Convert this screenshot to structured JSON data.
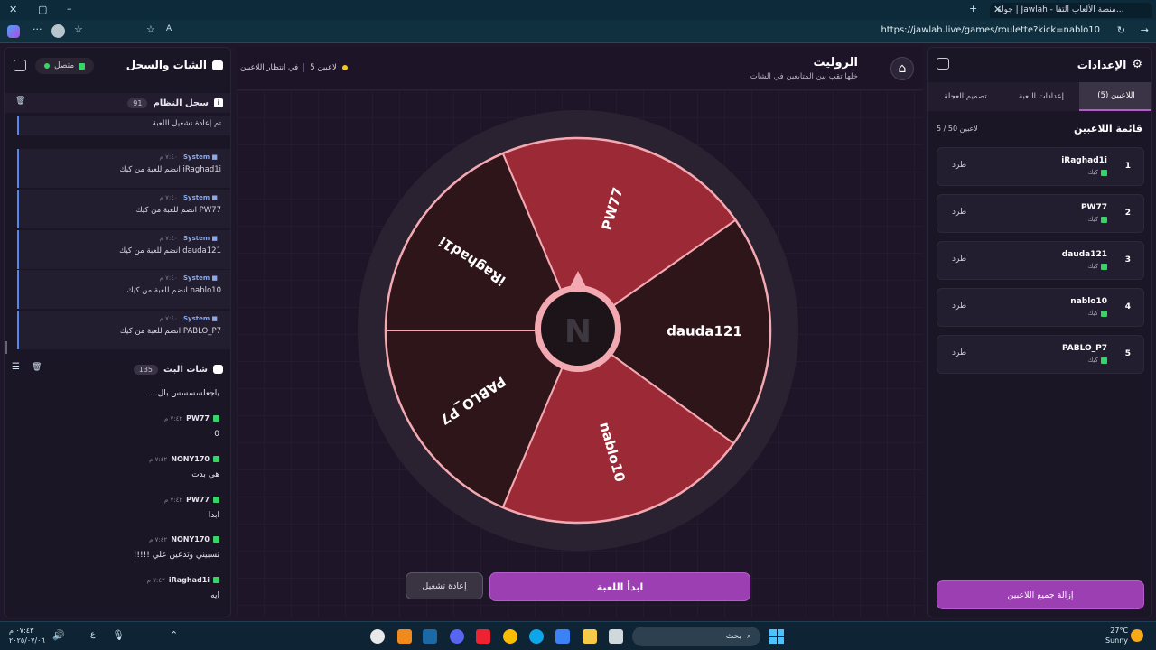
{
  "browser": {
    "tab_title": "جولة | Jawlah - منصة الألعاب التفا...",
    "url": "https://jawlah.live/games/roulette?kick=nablo10"
  },
  "chat": {
    "title": "الشات والسجل",
    "status": "متصل",
    "log_title": "سجل النظام",
    "log_count": "91",
    "log_items": [
      {
        "meta": "",
        "time": "",
        "text": "تم إعادة تشغيل اللعبة"
      },
      {
        "meta": "System",
        "time": "٧:٤٠ م",
        "text": "iRaghad1i انضم للعبة من كيك"
      },
      {
        "meta": "System",
        "time": "٧:٤٠ م",
        "text": "PW77 انضم للعبة من كيك"
      },
      {
        "meta": "System",
        "time": "٧:٤٠ م",
        "text": "dauda121 انضم للعبة من كيك"
      },
      {
        "meta": "System",
        "time": "٧:٤٠ م",
        "text": "nablo10 انضم للعبة من كيك"
      },
      {
        "meta": "System",
        "time": "٧:٤٠ م",
        "text": "PABLO_P7 انضم للعبة من كيك"
      }
    ],
    "live_title": "شات البث",
    "live_count": "135",
    "first_text": "ياجعلسسسس بال...",
    "messages": [
      {
        "user": "PW77",
        "time": "٧:٤٢ م",
        "text": "0"
      },
      {
        "user": "NONY170",
        "time": "٧:٤٢ م",
        "text": "هي بدت"
      },
      {
        "user": "PW77",
        "time": "٧:٤٢ م",
        "text": "ابدا"
      },
      {
        "user": "NONY170",
        "time": "٧:٤٢ م",
        "text": "تسبيني وتدعين علي !!!!!"
      },
      {
        "user": "iRaghad1i",
        "time": "٧:٤٢ م",
        "text": "ايه"
      }
    ]
  },
  "main": {
    "title": "الروليت",
    "subtitle": "خلها تقب بين المتابعين في الشات",
    "waiting": "في انتظار اللاعبين",
    "players_count": "5 لاعبين",
    "start_button": "ابدأ اللعبة",
    "restart_button": "إعادة تشغيل",
    "wheel": {
      "segments": [
        {
          "name": "PW77",
          "color": "#9b2a36"
        },
        {
          "name": "dauda121",
          "color": "#2e1519"
        },
        {
          "name": "nablo10",
          "color": "#9b2a36"
        },
        {
          "name": "PABLO_P7",
          "color": "#2e1519"
        },
        {
          "name": "iRaghad1i",
          "color": "#2e1519"
        }
      ]
    }
  },
  "settings": {
    "title": "الإعدادات",
    "tabs": [
      "اللاعبين (5)",
      "إعدادات اللعبة",
      "تصميم العجلة"
    ],
    "list_title": "قائمة اللاعبين",
    "list_count": "5 / 50 لاعبين",
    "kick_label": "طرد",
    "platform": "كيك",
    "players": [
      {
        "num": "1",
        "name": "iRaghad1i"
      },
      {
        "num": "2",
        "name": "PW77"
      },
      {
        "num": "3",
        "name": "dauda121"
      },
      {
        "num": "4",
        "name": "nablo10"
      },
      {
        "num": "5",
        "name": "PABLO_P7"
      }
    ],
    "remove_all": "إزالة جميع اللاعبين"
  },
  "taskbar": {
    "search": "بحث",
    "time": "٠٧:٤٣ م",
    "date": "٢٠٢٥/٠٧/٠٦",
    "weather": "27°C",
    "weather_desc": "Sunny",
    "lang": "ع"
  },
  "colors": {
    "accent": "#9c3fb3",
    "kick_green": "#3ad36b",
    "wheel_light": "#9b2a36",
    "wheel_dark": "#2e1519",
    "wheel_border": "#f3a9b1"
  }
}
